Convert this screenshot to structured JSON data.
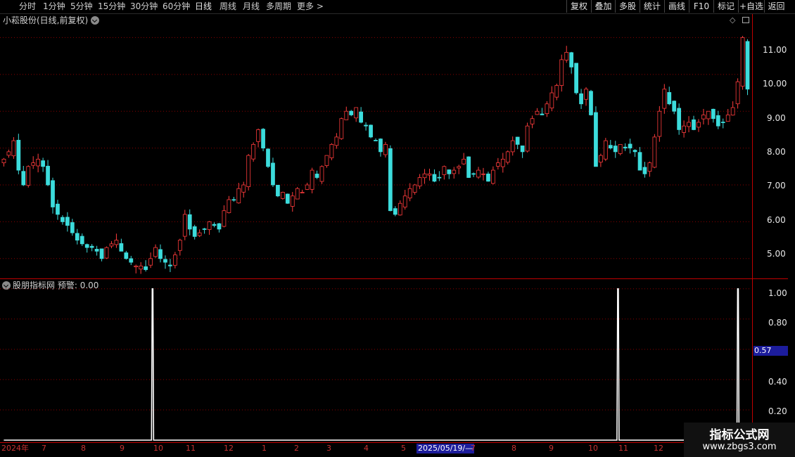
{
  "toolbar": {
    "periods": [
      "分时",
      "1分钟",
      "5分钟",
      "15分钟",
      "30分钟",
      "60分钟",
      "日线",
      "周线",
      "月线",
      "多周期",
      "更多"
    ],
    "buttons": [
      "复权",
      "叠加",
      "多股",
      "统计",
      "画线",
      "F10",
      "标记",
      "+自选",
      "返回"
    ]
  },
  "main_chart": {
    "title": "小菘股份(日线,前复权)",
    "y_ticks": [
      "11.00",
      "10.00",
      "9.00",
      "8.00",
      "7.00",
      "6.00",
      "5.00"
    ]
  },
  "indicator": {
    "title": "股朋指标网",
    "series_label": "预警: 0.00",
    "y_ticks": [
      "1.00",
      "0.80",
      "0.57",
      "0.40",
      "0.20"
    ],
    "cursor_value": "0.57"
  },
  "x_axis": {
    "labels": [
      "2024年",
      "7",
      "8",
      "9",
      "10",
      "11",
      "12",
      "1",
      "2",
      "3",
      "4",
      "5",
      "7",
      "8",
      "9",
      "10",
      "11",
      "12"
    ],
    "cursor_date": "2025/05/19/—"
  },
  "watermark": {
    "title": "指标公式网",
    "url": "www.zbgs3.com"
  },
  "colors": {
    "up": "#ff3c3c",
    "down": "#3cdcdc",
    "grid": "#8b0000",
    "signal": "#ffffff"
  },
  "chart_data": {
    "type": "candlestick",
    "price_ylim": [
      4.5,
      11.6
    ],
    "indicator_ylim": [
      0,
      1.05
    ],
    "close": [
      7.7,
      7.9,
      8.2,
      7.4,
      7.0,
      7.5,
      7.6,
      7.7,
      7.5,
      7.0,
      6.4,
      6.2,
      6.0,
      5.9,
      5.7,
      5.5,
      5.4,
      5.3,
      5.3,
      5.2,
      5.0,
      5.3,
      5.4,
      5.5,
      5.2,
      5.0,
      4.9,
      4.8,
      4.8,
      4.7,
      5.0,
      5.3,
      5.0,
      4.9,
      4.8,
      5.1,
      5.5,
      6.2,
      5.8,
      5.6,
      5.7,
      5.8,
      6.0,
      5.9,
      5.8,
      6.3,
      6.6,
      6.6,
      6.9,
      7.0,
      7.8,
      8.1,
      8.5,
      8.0,
      7.5,
      7.0,
      6.7,
      6.8,
      6.5,
      6.7,
      6.9,
      6.8,
      7.0,
      7.4,
      7.2,
      7.5,
      7.8,
      8.1,
      8.3,
      8.8,
      9.0,
      8.9,
      9.1,
      8.7,
      8.6,
      8.3,
      8.2,
      7.9,
      8.1,
      6.3,
      6.2,
      6.5,
      6.7,
      6.9,
      7.0,
      7.2,
      7.3,
      7.3,
      7.1,
      7.2,
      7.5,
      7.3,
      7.4,
      7.5,
      7.7,
      7.2,
      7.3,
      7.4,
      7.3,
      7.1,
      7.4,
      7.6,
      7.7,
      7.9,
      8.2,
      8.1,
      7.9,
      8.6,
      8.8,
      9.0,
      8.9,
      9.2,
      9.5,
      9.7,
      10.4,
      10.6,
      10.2,
      9.5,
      9.2,
      9.6,
      8.9,
      7.5,
      7.8,
      8.2,
      8.0,
      7.9,
      8.1,
      8.0,
      8.0,
      7.9,
      7.4,
      7.3,
      7.6,
      8.3,
      9.0,
      9.6,
      9.2,
      9.0,
      8.5,
      8.6,
      8.7,
      8.5,
      8.7,
      8.9,
      9.0,
      8.8,
      8.6,
      8.7,
      8.9,
      9.1,
      9.8,
      11.0,
      9.6
    ],
    "alert": {
      "total_points": 156,
      "spike_indices": [
        31,
        128,
        153
      ],
      "values": [
        1,
        1,
        1
      ]
    }
  }
}
